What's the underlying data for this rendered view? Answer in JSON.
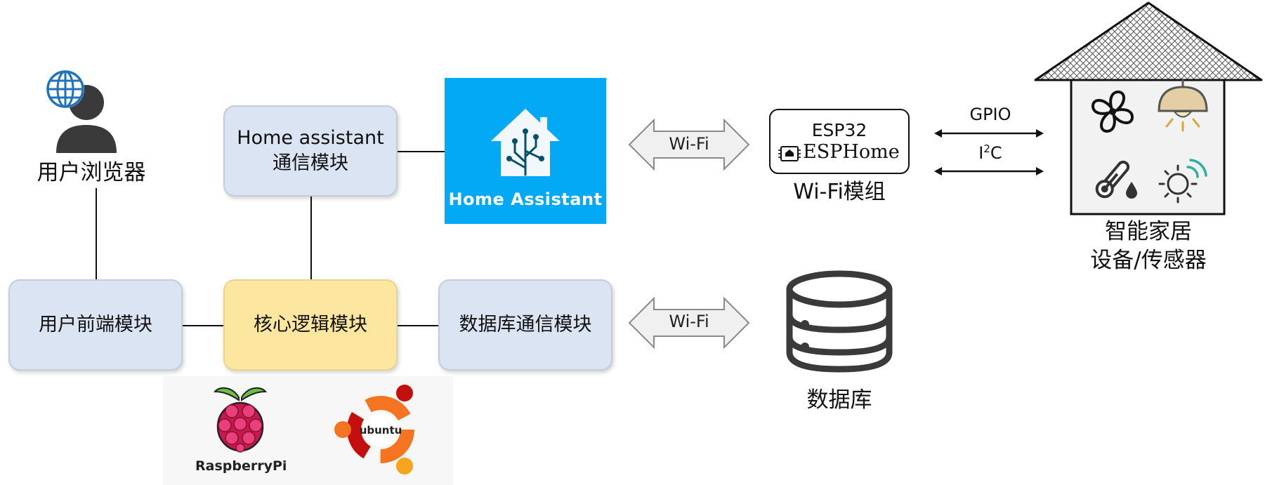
{
  "user": {
    "label": "用户浏览器"
  },
  "modules": {
    "ha_comm": {
      "line1": "Home assistant",
      "line2": "通信模块"
    },
    "frontend": {
      "label": "用户前端模块"
    },
    "core": {
      "label": "核心逻辑模块"
    },
    "db_comm": {
      "label": "数据库通信模块"
    }
  },
  "home_assistant": {
    "label": "Home Assistant",
    "color": "#03a9f4"
  },
  "links": {
    "wifi_top": "Wi-Fi",
    "wifi_bottom": "Wi-Fi",
    "gpio": "GPIO",
    "i2c_main": "I",
    "i2c_sup": "2",
    "i2c_tail": "C"
  },
  "esp": {
    "chip": "ESP32",
    "firmware": "ESPHome",
    "caption": "Wi-Fi模组"
  },
  "house": {
    "line1": "智能家居",
    "line2": "设备/传感器"
  },
  "database": {
    "label": "数据库"
  },
  "platform": {
    "raspberry": "RaspberryPi",
    "ubuntu": "ubuntu"
  },
  "colors": {
    "module_fill": "#dbe4f3",
    "core_fill": "#fde7a0",
    "ha_blue": "#03a9f4",
    "arrow_fill": "#f0f0f0",
    "raspberry_red": "#c51a4a",
    "raspberry_green": "#6cc04a",
    "ubuntu_orange": "#f47421",
    "ubuntu_red": "#c40f0f"
  }
}
